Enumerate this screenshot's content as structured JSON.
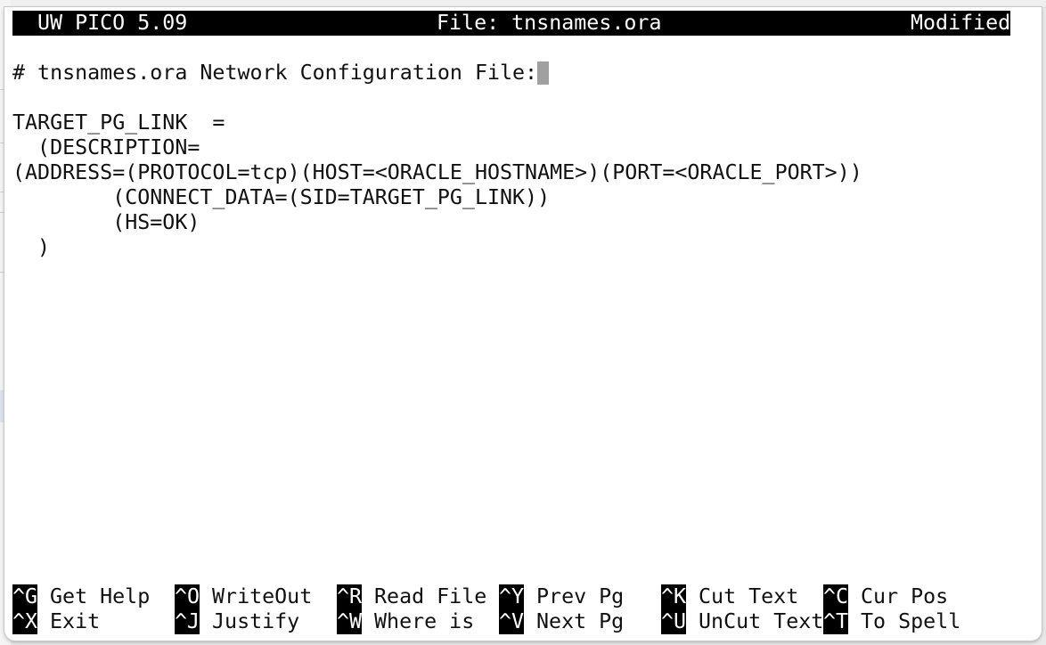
{
  "editor": {
    "app_name": "UW PICO 5.09",
    "file_label": "File: tnsnames.ora",
    "status": "Modified"
  },
  "buffer": {
    "lines": [
      "",
      "# tnsnames.ora Network Configuration File:",
      "",
      "TARGET_PG_LINK  =",
      "  (DESCRIPTION=",
      "(ADDRESS=(PROTOCOL=tcp)(HOST=<ORACLE_HOSTNAME>)(PORT=<ORACLE_PORT>))",
      "        (CONNECT_DATA=(SID=TARGET_PG_LINK))",
      "        (HS=OK)",
      "  )"
    ],
    "cursor_line": 1
  },
  "shortcuts": [
    {
      "key": "^G",
      "label": "Get Help"
    },
    {
      "key": "^X",
      "label": "Exit"
    },
    {
      "key": "^O",
      "label": "WriteOut"
    },
    {
      "key": "^J",
      "label": "Justify"
    },
    {
      "key": "^R",
      "label": "Read File"
    },
    {
      "key": "^W",
      "label": "Where is"
    },
    {
      "key": "^Y",
      "label": "Prev Pg"
    },
    {
      "key": "^V",
      "label": "Next Pg"
    },
    {
      "key": "^K",
      "label": "Cut Text"
    },
    {
      "key": "^U",
      "label": "UnCut Text"
    },
    {
      "key": "^C",
      "label": "Cur Pos"
    },
    {
      "key": "^T",
      "label": "To Spell"
    }
  ]
}
